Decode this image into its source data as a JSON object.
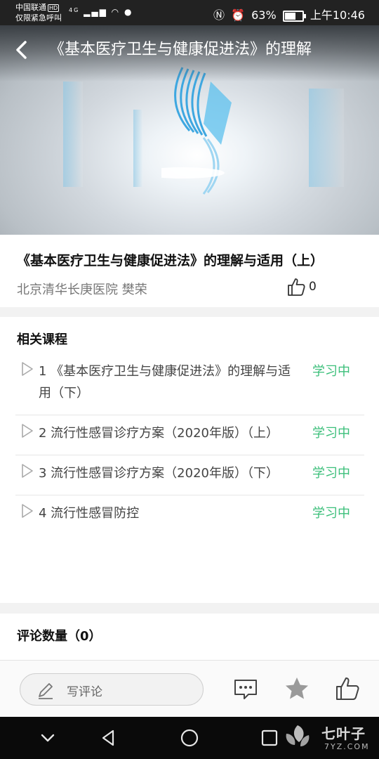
{
  "status_bar": {
    "carrier": "中国联通",
    "carrier_badge": "HD",
    "emergency": "仅限紧急呼叫",
    "battery": "63%",
    "time": "上午10:46",
    "net": "4G"
  },
  "header": {
    "title": "《基本医疗卫生与健康促进法》的理解"
  },
  "course": {
    "title": "《基本医疗卫生与健康促进法》的理解与适用（上）",
    "author": "北京清华长庚医院 樊荣",
    "likes": "0"
  },
  "related": {
    "heading": "相关课程",
    "items": [
      {
        "label": "1 《基本医疗卫生与健康促进法》的理解与适用（下）",
        "status": "学习中"
      },
      {
        "label": "2 流行性感冒诊疗方案（2020年版）（上）",
        "status": "学习中"
      },
      {
        "label": "3 流行性感冒诊疗方案（2020年版）（下）",
        "status": "学习中"
      },
      {
        "label": "4 流行性感冒防控",
        "status": "学习中"
      }
    ]
  },
  "comments": {
    "heading": "评论数量（0）"
  },
  "toolbar": {
    "write_placeholder": "写评论"
  },
  "watermark": {
    "name": "七叶子",
    "domain": "7YZ.COM"
  },
  "colors": {
    "accent_green": "#3bbf7a",
    "status_bar": "#222222",
    "nav_bar": "#0a0a0a"
  },
  "icons": [
    "back-arrow-icon",
    "thumbs-up-icon",
    "play-outline-icon",
    "pen-icon",
    "chat-bubble-icon",
    "star-icon",
    "nav-back-icon",
    "nav-home-icon",
    "nav-recent-icon",
    "nav-down-icon"
  ]
}
